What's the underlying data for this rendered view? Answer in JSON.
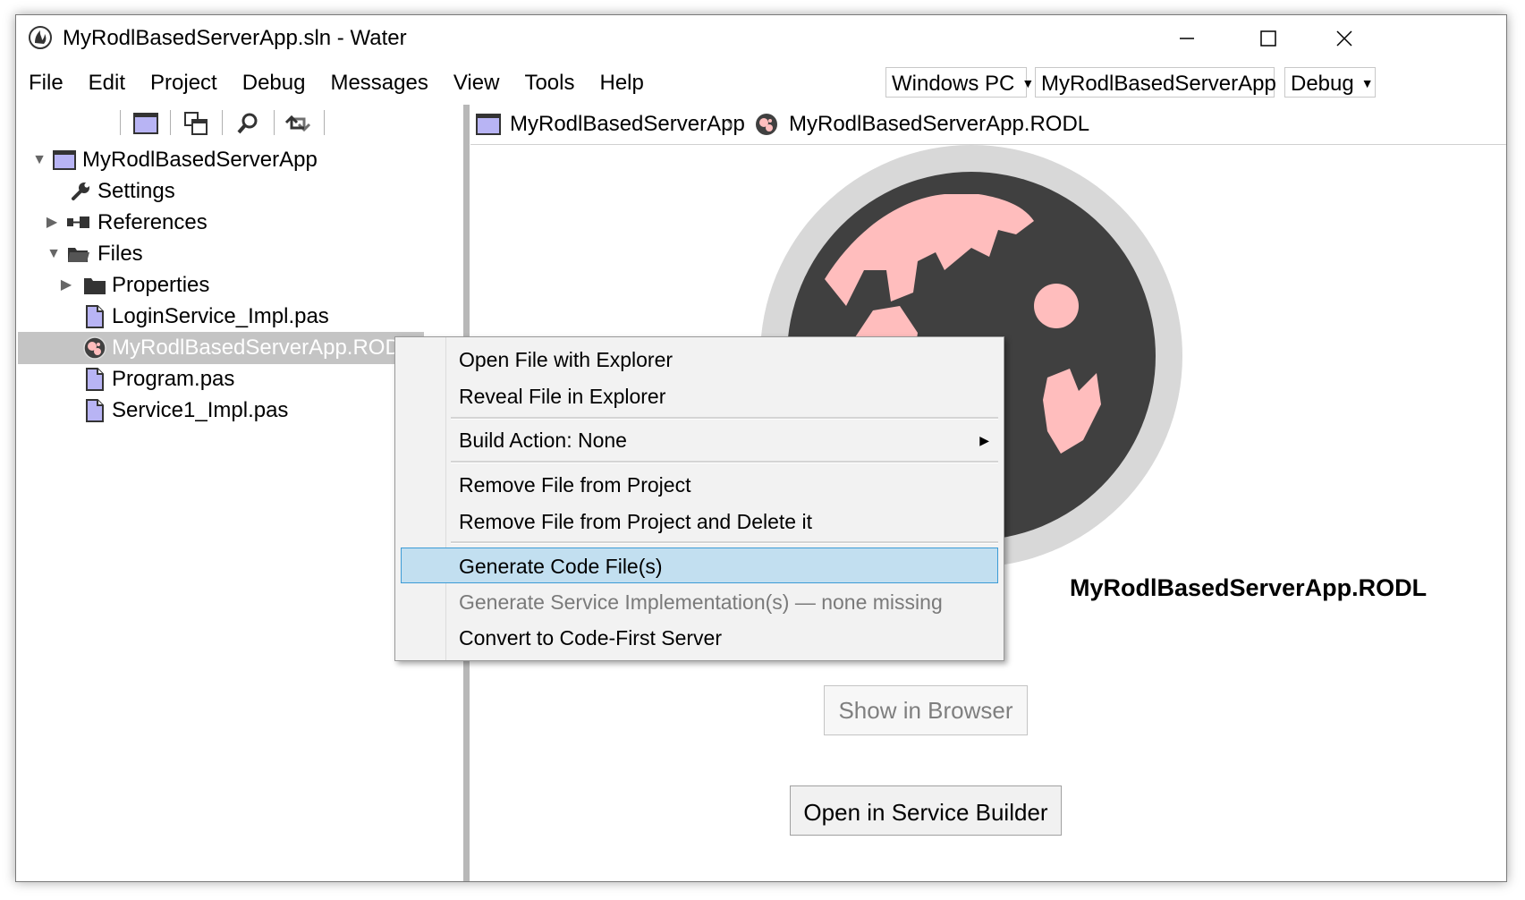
{
  "window": {
    "title": "MyRodlBasedServerApp.sln - Water",
    "controls": {
      "minimize": "—",
      "maximize": "☐",
      "close": "✕"
    }
  },
  "menubar": {
    "items": [
      "File",
      "Edit",
      "Project",
      "Debug",
      "Messages",
      "View",
      "Tools",
      "Help"
    ]
  },
  "target_selectors": {
    "platform": "Windows PC",
    "project": "MyRodlBasedServerApp",
    "configuration": "Debug"
  },
  "toolbar": {
    "icons": [
      "project-view-icon",
      "windows-icon",
      "search-icon",
      "sync-icon"
    ]
  },
  "solution_tree": {
    "root": "MyRodlBasedServerApp",
    "settings": "Settings",
    "references": "References",
    "files": "Files",
    "properties": "Properties",
    "file_items": [
      "LoginService_Impl.pas",
      "MyRodlBasedServerApp.RODL",
      "Program.pas",
      "Service1_Impl.pas"
    ],
    "selected": "MyRodlBasedServerApp.RODL"
  },
  "breadcrumb": {
    "project": "MyRodlBasedServerApp",
    "separator": "›",
    "file": "MyRodlBasedServerApp.RODL"
  },
  "content": {
    "file_title": "MyRodlBasedServerApp.RODL",
    "show_in_browser": "Show in Browser",
    "open_in_service_builder": "Open in Service Builder"
  },
  "context_menu": {
    "open_with_explorer": "Open File with Explorer",
    "reveal_in_explorer": "Reveal File in Explorer",
    "build_action": "Build Action: None",
    "remove_from_project": "Remove File from Project",
    "remove_and_delete": "Remove File from Project and Delete it",
    "generate_code": "Generate Code File(s)",
    "generate_service_impl": "Generate Service Implementation(s) — none missing",
    "convert_code_first": "Convert to Code-First Server"
  },
  "colors": {
    "logo_dark": "#404040",
    "logo_pink": "#ffbdbd",
    "logo_ring": "#d8d8d8",
    "selection_bg": "#c4c4c4",
    "menu_highlight": "#c2dff0",
    "menu_highlight_border": "#3c9bd6",
    "project_icon": "#b8b4f4"
  }
}
